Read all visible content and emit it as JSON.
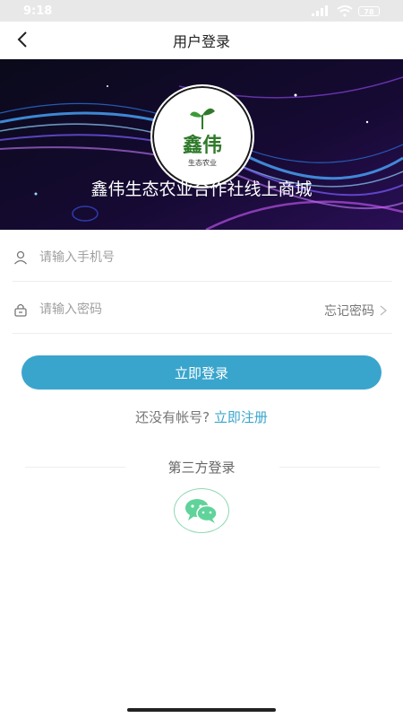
{
  "status_bar": {
    "time": "9:18",
    "battery": "78"
  },
  "header": {
    "title": "用户登录"
  },
  "banner": {
    "logo_name": "鑫伟",
    "logo_subtitle": "生态农业",
    "shop_name": "鑫伟生态农业合作社线上商城"
  },
  "form": {
    "phone_placeholder": "请输入手机号",
    "password_placeholder": "请输入密码",
    "forgot_password": "忘记密码",
    "login_button": "立即登录",
    "no_account_text": "还没有帐号?",
    "register_link": "立即注册"
  },
  "third_party": {
    "label": "第三方登录",
    "providers": [
      "wechat-icon"
    ]
  },
  "colors": {
    "accent": "#3aa5cc",
    "wechat": "#5fd39a",
    "logo_green": "#2f7a2a"
  }
}
